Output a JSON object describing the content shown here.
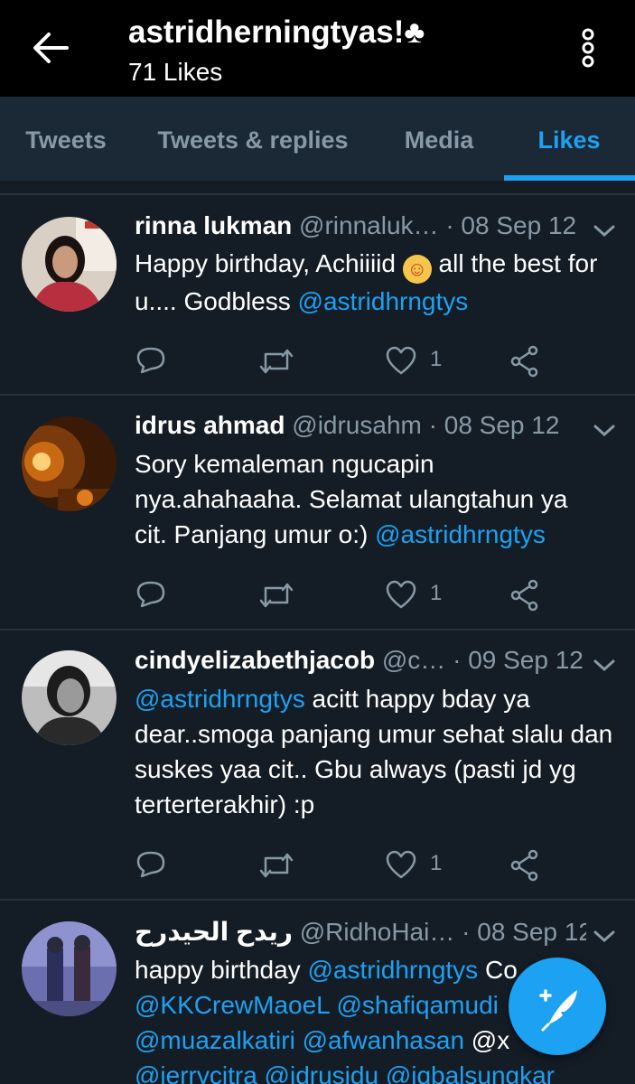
{
  "header": {
    "title": "astridherningtyas!♣",
    "subtitle": "71 Likes"
  },
  "tabs": [
    {
      "label": "Tweets"
    },
    {
      "label": "Tweets & replies"
    },
    {
      "label": "Media"
    },
    {
      "label": "Likes"
    }
  ],
  "active_tab": "Likes",
  "colors": {
    "accent": "#1da1f2",
    "background": "#141d26",
    "secondary_text": "#8899a6",
    "top_bar": "#000000",
    "tab_bar": "#1b2836"
  },
  "tweets": [
    {
      "name": "rinna lukman",
      "handle": "@rinnaluk…",
      "sep": "·",
      "date": "08 Sep 12",
      "text": [
        "Happy birthday, Achiiiid ",
        "☺",
        " all the best for u.... Godbless ",
        "@astridhrngtys"
      ],
      "likes": "1"
    },
    {
      "name": "idrus ahmad",
      "handle": "@idrusahm",
      "sep": "·",
      "date": "08 Sep 12",
      "text": [
        "Sory kemaleman ngucapin nya.ahahaaha. Selamat ulangtahun ya cit. Panjang umur o:) ",
        "@astridhrngtys"
      ],
      "likes": "1"
    },
    {
      "name": "cindyelizabethjacob",
      "handle": "@c…",
      "sep": "·",
      "date": "09 Sep 12",
      "text": [
        "@astridhrngtys",
        " acitt happy bday ya dear..smoga panjang umur sehat slalu dan suskes yaa cit.. Gbu always (pasti jd yg terterterakhir) :p"
      ],
      "likes": "1"
    },
    {
      "name": "ريدح الحيدرح",
      "handle": "@RidhoHai…",
      "sep": "·",
      "date": "08 Sep 12",
      "text": [
        "happy birthday ",
        "@astridhrngtys",
        " Co",
        "@KKCrewMaoeL",
        " ",
        "@shafiqamudi",
        "@muazalkatiri",
        " ",
        "@afwanhasan",
        " @x",
        "@jerrycitra",
        " ",
        "@idrusidu",
        " ",
        "@iqbalsungkar"
      ]
    }
  ],
  "icons": {
    "back": "arrow-left-icon",
    "more": "more-vertical-icon",
    "reply": "reply-icon",
    "retweet": "retweet-icon",
    "like": "heart-icon",
    "share": "share-icon",
    "caret": "chevron-down-icon",
    "compose": "compose-tweet-icon"
  }
}
